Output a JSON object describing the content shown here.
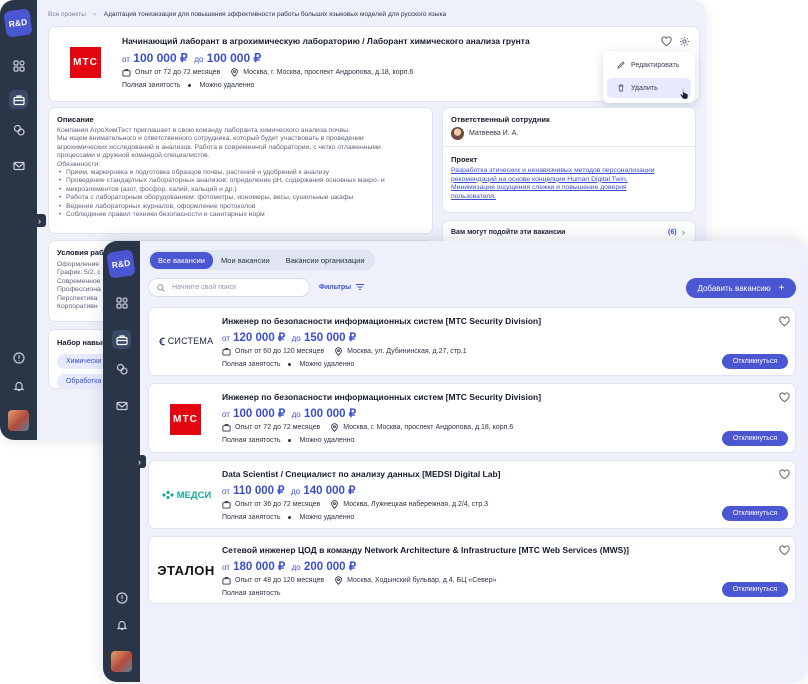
{
  "brand": {
    "logo": "R&D",
    "accent": "#4b56d2",
    "sidebar_bg": "#2a3547",
    "mts_red": "#e30611",
    "salary_color": "#3c4fd0"
  },
  "back": {
    "breadcrumb": {
      "root": "Все проекты",
      "current": "Адаптация тонизизации для повышения эффективности работы больших языковых моделей для русского языка"
    },
    "vacancy": {
      "logo_text": "МТС",
      "title": "Начинающий лаборант в агрохимическую лабораторию / Лаборант химического анализа грунта",
      "salary_from_pre": "от",
      "salary_from": "100 000 ₽",
      "salary_to_pre": "до",
      "salary_to": "100 000 ₽",
      "experience": "Опыт от 72 до 72 месяцев",
      "location": "Москва, г. Москва, проспект Андропова, д.18, корп.6",
      "employment": "Полная занятость",
      "schedule": "Можно удаленно"
    },
    "menu": {
      "edit": "Редактировать",
      "delete": "Удалить"
    },
    "description": {
      "title": "Описание",
      "intro": [
        "Компания АгроХимТест приглашает в свою команду лаборанта химического анализа почвы.",
        " Мы ищем внимательного и ответственного сотрудника, который будет участвовать в проведении",
        "агрохимических исследований и анализов. Работа в современной лаборатории, с четко отлаженными",
        "процессами и дружной командой специалистов.",
        "Обязанности:"
      ],
      "bullets": [
        "Прием, маркировка и подготовка образцов почвы, растений и удобрений к анализу",
        "Проведение стандартных лабораторных анализов: определение pH, содержания основных макро- и",
        "микроэлементов (азот, фосфор, калий, кальций и др.)",
        "Работа с лабораторным оборудованием: фотометры, иономеры, весы, сушильные шкафы",
        "Ведение лабораторных журналов, оформление протоколов",
        "Соблюдение правил техники безопасности и санитарных норм"
      ]
    },
    "conditions": {
      "title": "Условия рабо",
      "lines": [
        "Оформление",
        "График: 5/2, с",
        "Современное",
        "Профессиона",
        "Перспектива",
        "Корпоративн"
      ]
    },
    "skills": {
      "title": "Набор навык",
      "chips": [
        "Химически",
        "Обработка"
      ]
    },
    "responsible": {
      "title": "Ответственный сотрудник",
      "name": "Матвеева И. А."
    },
    "project": {
      "title": "Проект",
      "link": [
        "Разработка этических и ненавязчивых методов персонализации",
        "рекомендаций на основе концепции Human Digital Twin.",
        "Минимизация ощущения слежки и повышение доверия",
        "пользователя."
      ]
    },
    "suggest": {
      "label": "Вам могут подойти эти вакансии",
      "count": "(6)"
    }
  },
  "front": {
    "tabs": [
      "Все вакансии",
      "Мои вакансии",
      "Вакансии организации"
    ],
    "search_placeholder": "Начните свой поиск",
    "filters": "Фильтры",
    "add_button": "Добавить вакансию",
    "apply_label": "Откликнуться",
    "vacancies": [
      {
        "company": "СИСТЕМА",
        "title": "Инженер по безопасности информационных систем [МТС Security Division]",
        "from_pre": "от",
        "from": "120 000 ₽",
        "to_pre": "до",
        "to": "150 000 ₽",
        "experience": "Опыт от 60 до 120 месяцев",
        "location": "Москва, ул. Дубининская, д.27, стр.1",
        "employment": "Полная занятость",
        "schedule": "Можно удаленно"
      },
      {
        "company": "МТС",
        "title": "Инженер по безопасности информационных систем [МТС Security Division]",
        "from_pre": "от",
        "from": "100 000 ₽",
        "to_pre": "до",
        "to": "100 000 ₽",
        "experience": "Опыт от 72 до 72 месяцев",
        "location": "Москва, г. Москва, проспект Андропова, д.18, корп.6",
        "employment": "Полная занятость",
        "schedule": "Можно удаленно"
      },
      {
        "company": "МЕДСИ",
        "title": "Data Scientist / Специалист по анализу данных [MEDSI Digital Lab]",
        "from_pre": "от",
        "from": "110 000 ₽",
        "to_pre": "до",
        "to": "140 000 ₽",
        "experience": "Опыт от 36 до 72 месяцев",
        "location": "Москва, Лужнецкая набережная, д.2/4, стр.3",
        "employment": "Полная занятость",
        "schedule": "Можно удаленно"
      },
      {
        "company": "ЭТАЛОН",
        "title": "Сетевой инженер ЦОД в команду Network Architecture & Infrastructure [МТС Web Services (MWS)]",
        "from_pre": "от",
        "from": "180 000 ₽",
        "to_pre": "до",
        "to": "200 000 ₽",
        "experience": "Опыт от 48 до 120 месяцев",
        "location": "Москва, Ходынский бульвар, д.4, БЦ «Север»",
        "employment": "Полная занятость"
      }
    ]
  }
}
